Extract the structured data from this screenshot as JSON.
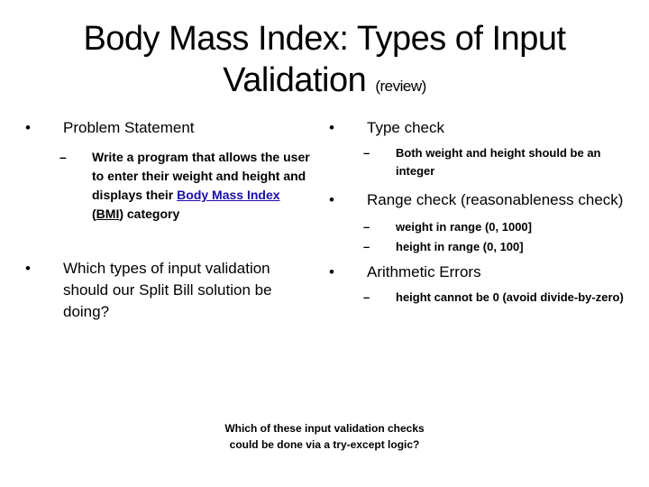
{
  "slide": {
    "title_line1": "Body Mass Index: Types of Input",
    "title_line2": "Validation",
    "title_suffix": "(review)",
    "bullet_glyph": "•",
    "dash_glyph": "–",
    "left": {
      "problem_heading": "Problem Statement",
      "problem_text_before": "Write a program that allows the user to enter their weight and height and displays their ",
      "problem_link": "Body Mass Index",
      "problem_paren_open": " (",
      "problem_abbr": "BMI",
      "problem_text_after": ") category",
      "question": "Which types of input validation should our Split Bill solution be doing?"
    },
    "right": {
      "items": [
        {
          "heading": "Type check",
          "subs": [
            "Both weight and height should be an integer"
          ]
        },
        {
          "heading": "Range check (reasonableness check)",
          "subs": [
            "weight in range (0, 1000]",
            "height in range (0, 100]"
          ]
        },
        {
          "heading": "Arithmetic Errors",
          "subs": [
            "height cannot be 0 (avoid divide-by-zero)"
          ]
        }
      ]
    },
    "note_line1": "Which of these input validation checks",
    "note_line2": "could be done via a try-except logic?"
  }
}
